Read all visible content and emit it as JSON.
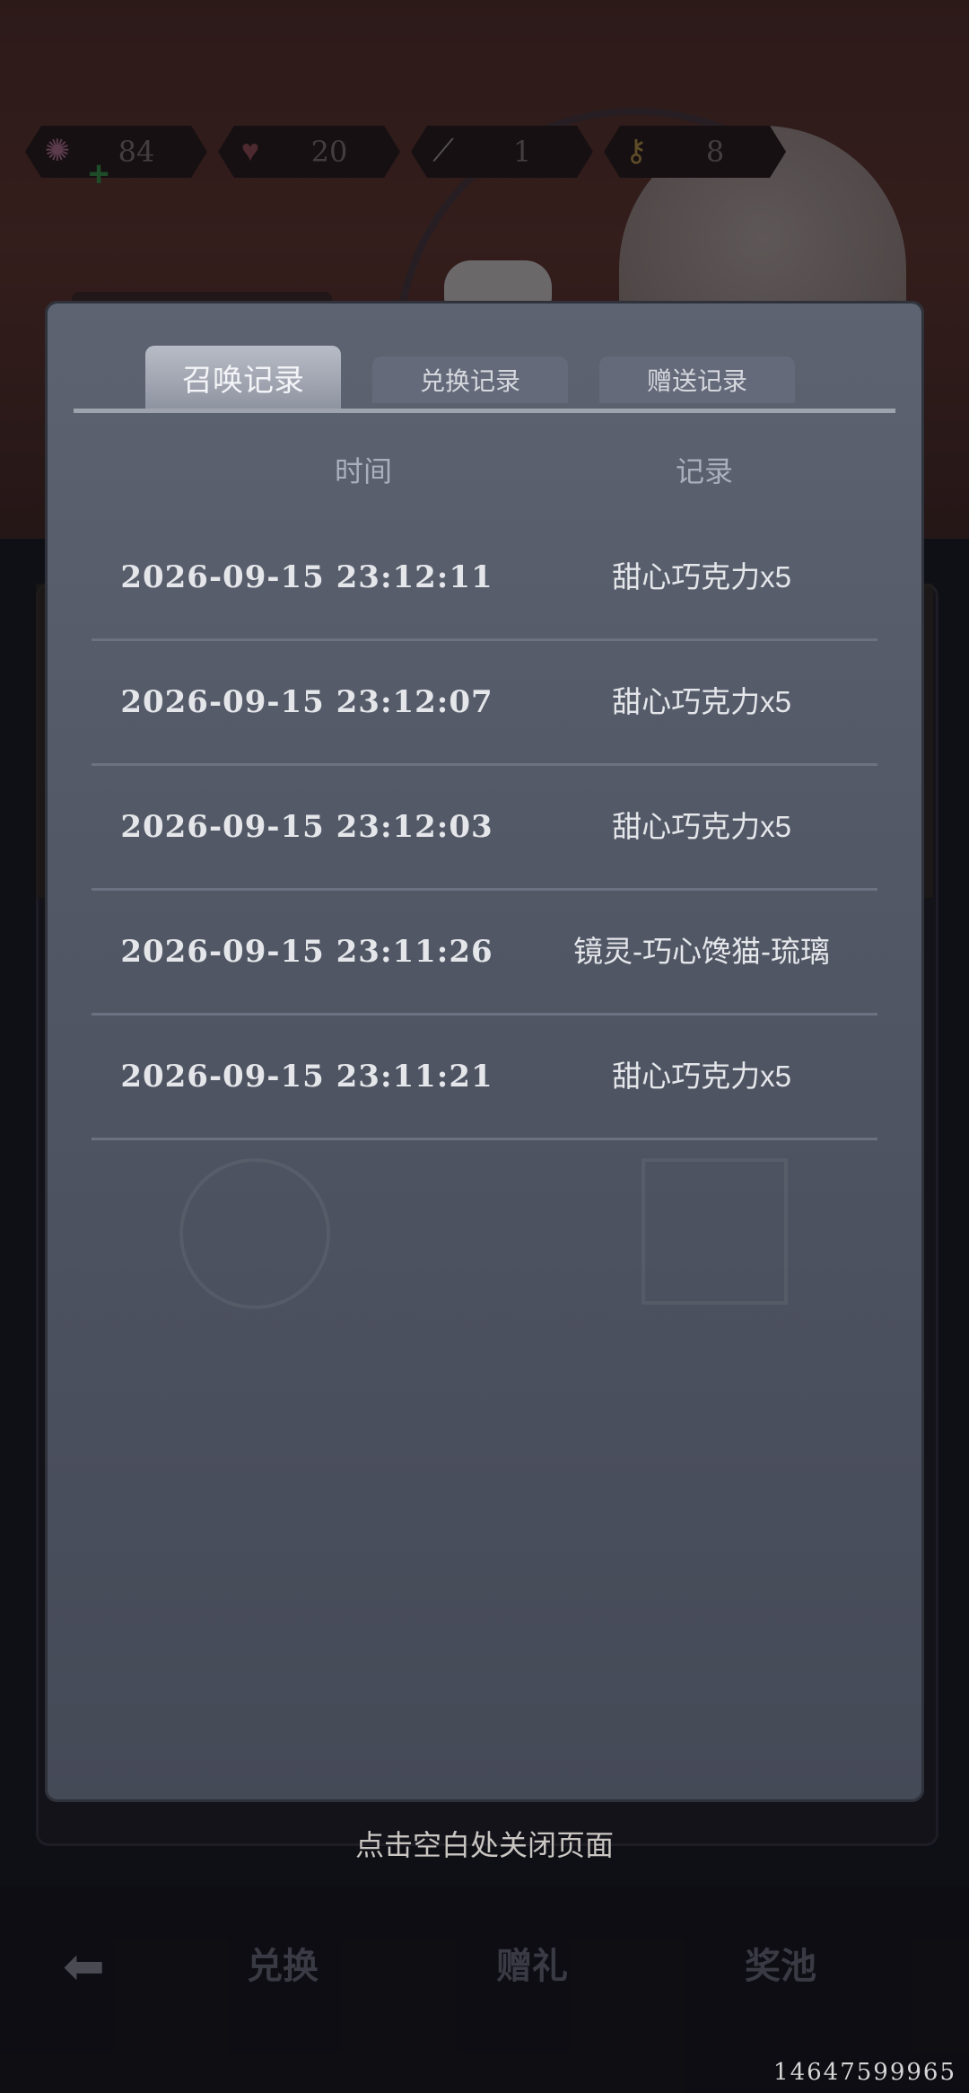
{
  "currencies": [
    {
      "icon": "candy-icon",
      "value": "84"
    },
    {
      "icon": "chocolate-heart-icon",
      "value": "20"
    },
    {
      "icon": "spoon-icon",
      "value": "1"
    },
    {
      "icon": "lollipop-key-icon",
      "value": "8"
    }
  ],
  "modal": {
    "tabs": [
      {
        "label": "召唤记录",
        "active": true
      },
      {
        "label": "兑换记录",
        "active": false
      },
      {
        "label": "赠送记录",
        "active": false
      }
    ],
    "columns": {
      "time": "时间",
      "record": "记录"
    },
    "rows": [
      {
        "time": "2026-09-15  23:12:11",
        "record": "甜心巧克力x5"
      },
      {
        "time": "2026-09-15  23:12:07",
        "record": "甜心巧克力x5"
      },
      {
        "time": "2026-09-15  23:12:03",
        "record": "甜心巧克力x5"
      },
      {
        "time": "2026-09-15  23:11:26",
        "record": "镜灵-巧心馋猫-琉璃"
      },
      {
        "time": "2026-09-15  23:11:21",
        "record": "甜心巧克力x5"
      }
    ]
  },
  "close_hint": "点击空白处关闭页面",
  "bottom_nav": {
    "back_icon": "arrow-left-icon",
    "items": [
      "兑换",
      "赠礼",
      "奖池"
    ]
  },
  "footer_id": "14647599965"
}
